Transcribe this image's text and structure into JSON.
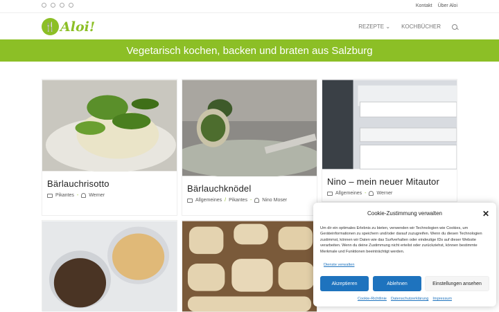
{
  "topbar": {
    "social_icons": [
      "facebook-icon",
      "pinterest-icon",
      "rss-icon",
      "mail-icon"
    ],
    "links": [
      "Kontakt",
      "Über Aloi"
    ]
  },
  "header": {
    "logo_text": "Aloi!",
    "nav": [
      {
        "label": "REZEPTE"
      },
      {
        "label": "KOCHBÜCHER"
      }
    ]
  },
  "banner": {
    "title": "Vegetarisch kochen, backen und braten aus Salzburg"
  },
  "posts": [
    {
      "title": "Bärlauchrisotto",
      "categories": [
        "Pikantes"
      ],
      "author": "Werner"
    },
    {
      "title": "Bärlauchknödel",
      "categories": [
        "Allgemeines",
        "Pikantes"
      ],
      "author": "Nino Moser"
    },
    {
      "title": "Nino – mein neuer Mitautor",
      "categories": [
        "Allgemeines"
      ],
      "author": "Werner"
    }
  ],
  "cookie": {
    "title": "Cookie-Zustimmung verwalten",
    "text": "Um dir ein optimales Erlebnis zu bieten, verwenden wir Technologien wie Cookies, um Geräteinformationen zu speichern und/oder darauf zuzugreifen. Wenn du diesen Technologien zustimmst, können wir Daten wie das Surfverhalten oder eindeutige IDs auf dieser Website verarbeiten. Wenn du deine Zustimmung nicht erteilst oder zurückziehst, können bestimmte Merkmale und Funktionen beeinträchtigt werden.",
    "services_link": "Dienste verwalten",
    "accept": "Akzeptieren",
    "deny": "Ablehnen",
    "settings": "Einstellungen ansehen",
    "policy_links": [
      "Cookie-Richtlinie",
      "Datenschutzerklärung",
      "Impressum"
    ]
  },
  "colors": {
    "brand": "#8cbf26",
    "link": "#1e73be"
  }
}
